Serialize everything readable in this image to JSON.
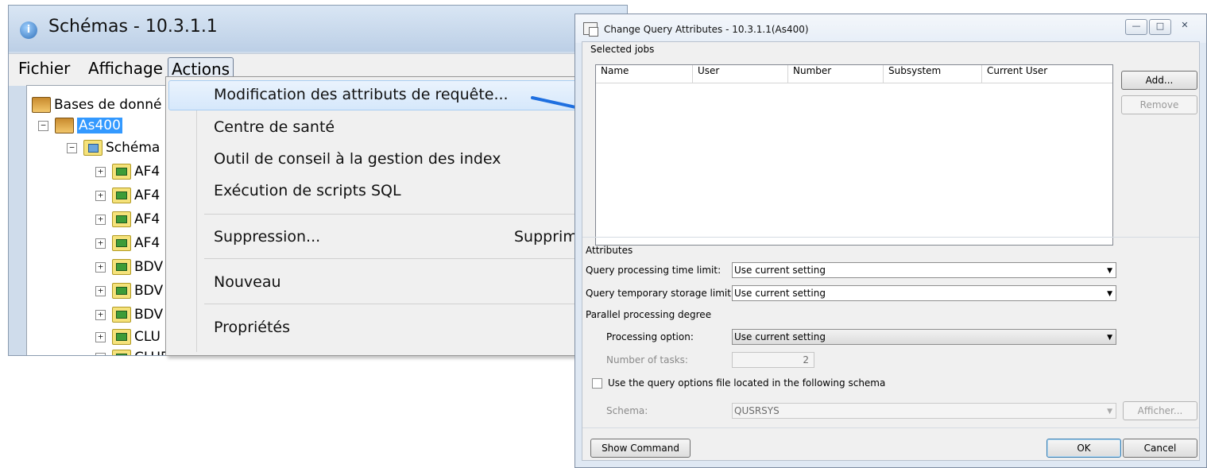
{
  "left_window": {
    "title": "Schémas - 10.3.1.1",
    "app_icon_glyph": "i",
    "menu": {
      "file": "Fichier",
      "view": "Affichage",
      "actions": "Actions"
    },
    "tree": {
      "root": "Bases de donné",
      "db": "As400",
      "schemas_node": "Schéma",
      "children": [
        "AF4",
        "AF4",
        "AF4",
        "AF4",
        "BDV",
        "BDV",
        "BDV",
        "CLU",
        "CLUBDTA"
      ]
    },
    "context_menu": {
      "items": [
        "Modification des attributs de requête...",
        "Centre de santé",
        "Outil de conseil à la gestion des index",
        "Exécution de scripts SQL",
        "Suppression...",
        "Nouveau",
        "Propriétés"
      ],
      "delete_shortcut": "Supprim"
    }
  },
  "arrow_color": "#1e6fe0",
  "dialog": {
    "title": "Change Query Attributes - 10.3.1.1(As400)",
    "window_buttons": {
      "minimize": "—",
      "maximize": "□",
      "close": "✕"
    },
    "selected_jobs": {
      "label": "Selected jobs",
      "columns": [
        "Name",
        "User",
        "Number",
        "Subsystem",
        "Current User"
      ],
      "add": "Add...",
      "remove": "Remove"
    },
    "attributes": {
      "label": "Attributes",
      "time_limit_label": "Query processing time limit:",
      "time_limit_value": "Use current setting",
      "storage_limit_label": "Query temporary storage limit:",
      "storage_limit_value": "Use current setting",
      "parallel_label": "Parallel processing degree",
      "processing_option_label": "Processing option:",
      "processing_option_value": "Use current setting",
      "tasks_label": "Number of tasks:",
      "tasks_value": "2",
      "options_file_label": "Use the query options file located in the following schema",
      "schema_label": "Schema:",
      "schema_value": "QUSRSYS",
      "show": "Afficher..."
    },
    "buttons": {
      "show_command": "Show Command",
      "ok": "OK",
      "cancel": "Cancel"
    }
  }
}
